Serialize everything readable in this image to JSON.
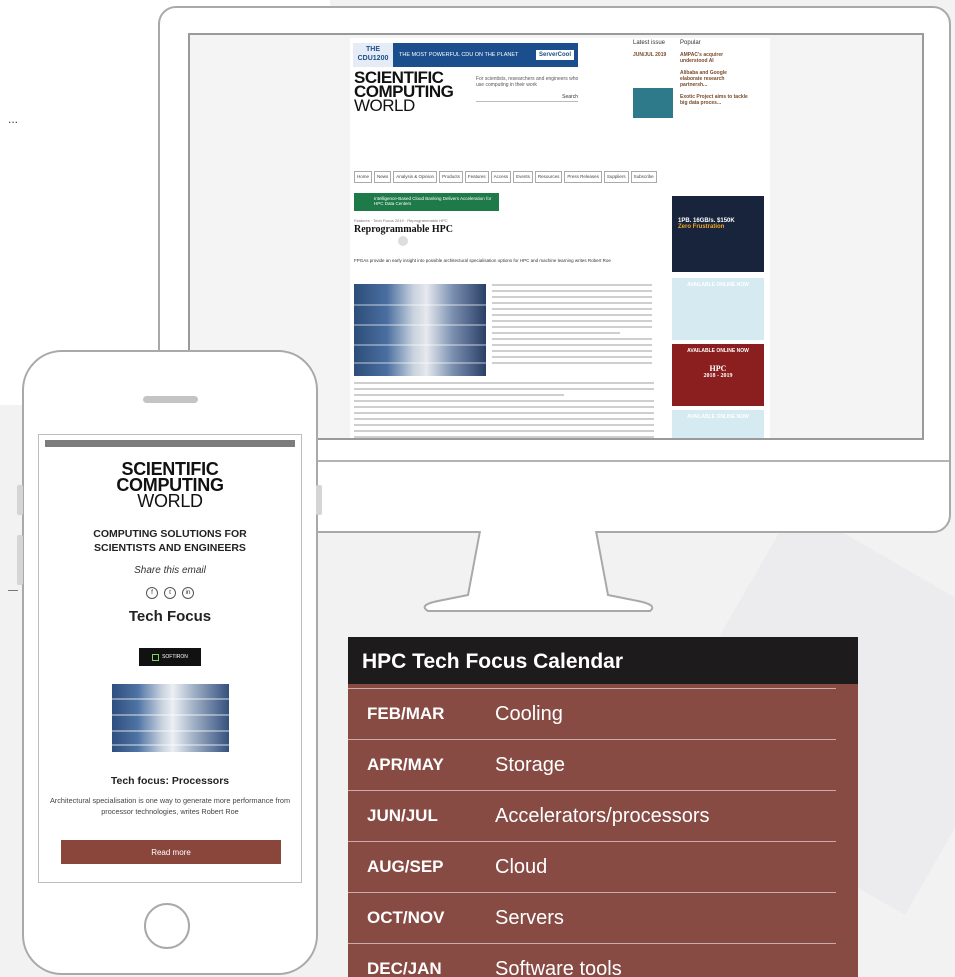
{
  "background": {
    "dots": "..."
  },
  "monitor": {
    "site": {
      "ad": {
        "cdu": "THE CDU1200",
        "tagline": "THE MOST POWERFUL CDU ON THE PLANET",
        "brand": "ServerCool"
      },
      "logo": {
        "line1": "SCIENTIFIC",
        "line2": "COMPUTING",
        "line3": "WORLD"
      },
      "tagline": "For scientists, researchers and engineers who use computing in their work",
      "search_label": "Search",
      "latest_issue": {
        "label": "Latest issue",
        "date": "JUN/JUL 2019"
      },
      "popular": {
        "label": "Popular",
        "items": [
          "AMPAC's acquirer understood AI",
          "Alibaba and Google elaborate research partnersh...",
          "Exotic Project aims to tackle big data proces..."
        ]
      },
      "nav": [
        "Home",
        "News",
        "Analysis & Opinion",
        "Products",
        "Features",
        "Access",
        "Events",
        "Resources",
        "Press Releases",
        "Suppliers",
        "Subscribe"
      ],
      "green_ad": "Intelligence-Based Cloud Banking Delivers Acceleration for HPC Data Centers",
      "breadcrumb": "Features · Tech Focus 2019 · Reprogrammable HPC",
      "article_title": "Reprogrammable HPC",
      "article_intro": "FPGAs provide an early insight into possible architectural specialisation options for HPC and machine learning writes Robert Roe",
      "side_ads": {
        "dark": {
          "line1": "1PB. 16GB/s. $150K",
          "line2": "Zero Frustration"
        },
        "light1": "AVAILABLE ONLINE NOW",
        "red": {
          "line1": "AVAILABLE ONLINE NOW",
          "line2": "HPC",
          "line3": "2018 - 2019"
        },
        "light2": "AVAILABLE ONLINE NOW"
      }
    }
  },
  "phone": {
    "logo": {
      "line1": "SCIENTIFIC",
      "line2": "COMPUTING",
      "line3": "WORLD"
    },
    "heading_line1": "COMPUTING SOLUTIONS FOR",
    "heading_line2": "SCIENTISTS AND ENGINEERS",
    "share_text": "Share this email",
    "social": [
      {
        "icon": "facebook-icon",
        "glyph": "f"
      },
      {
        "icon": "twitter-icon",
        "glyph": "t"
      },
      {
        "icon": "linkedin-icon",
        "glyph": "in"
      }
    ],
    "section_title": "Tech Focus",
    "sponsor": "SOFTIRON",
    "article_title": "Tech focus: Processors",
    "article_text": "Architectural specialisation is one way to generate more performance from processor technologies, writes Robert Roe",
    "read_more": "Read more"
  },
  "calendar": {
    "title": "HPC Tech Focus Calendar",
    "rows": [
      {
        "month": "FEB/MAR",
        "topic": "Cooling"
      },
      {
        "month": "APR/MAY",
        "topic": "Storage"
      },
      {
        "month": "JUN/JUL",
        "topic": "Accelerators/processors"
      },
      {
        "month": "AUG/SEP",
        "topic": "Cloud"
      },
      {
        "month": "OCT/NOV",
        "topic": "Servers"
      },
      {
        "month": "DEC/JAN",
        "topic": "Software tools"
      }
    ],
    "colors": {
      "header": "#1e1b1c",
      "body": "#874b44"
    }
  }
}
